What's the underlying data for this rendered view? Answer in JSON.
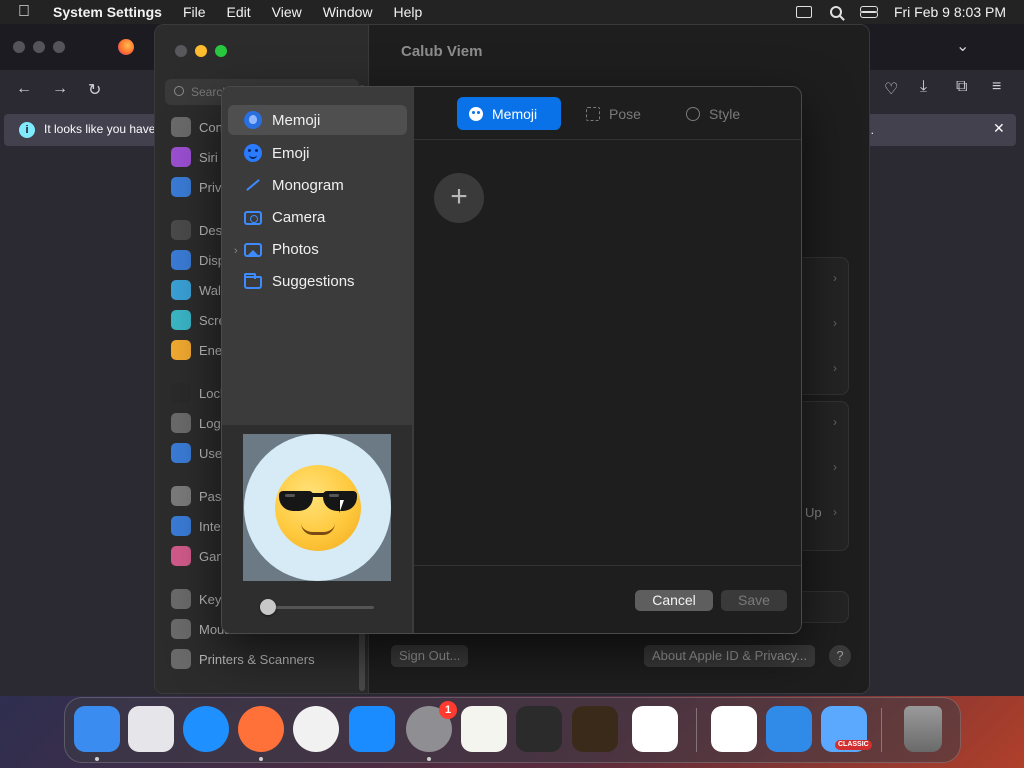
{
  "menubar": {
    "app_name": "System Settings",
    "menus": [
      "File",
      "Edit",
      "View",
      "Window",
      "Help"
    ],
    "clock": "Fri Feb 9  8:03 PM"
  },
  "browser": {
    "notice_text": "It looks like you haven't",
    "notice_suffix": "fox...",
    "close_glyph": "✕"
  },
  "settings": {
    "window_title": "Calub Viem",
    "search_placeholder": "Search",
    "sidebar_items": [
      {
        "label": "Con",
        "color": "#6a6a6a"
      },
      {
        "label": "Siri",
        "color": "#9b4fd1"
      },
      {
        "label": "Priv",
        "color": "#3a7bd5"
      },
      {
        "label": "Des",
        "color": "#4a4a4a"
      },
      {
        "label": "Disp",
        "color": "#3a7bd5"
      },
      {
        "label": "Wall",
        "color": "#3aa0d5"
      },
      {
        "label": "Scre",
        "color": "#3ab5c5"
      },
      {
        "label": "Ene",
        "color": "#f0a830"
      },
      {
        "label": "Lock",
        "color": "#2a2a2a"
      },
      {
        "label": "Logi",
        "color": "#6a6a6a"
      },
      {
        "label": "Use",
        "color": "#3a7bd5"
      },
      {
        "label": "Pass",
        "color": "#7a7a7a"
      },
      {
        "label": "Inter",
        "color": "#3a7bd5"
      },
      {
        "label": "Gam",
        "color": "#d05a8a"
      },
      {
        "label": "Keyb",
        "color": "#6a6a6a"
      },
      {
        "label": "Mouse",
        "color": "#6a6a6a"
      },
      {
        "label": "Printers & Scanners",
        "color": "#6a6a6a"
      }
    ],
    "up_text": "Up",
    "sign_out": "Sign Out...",
    "about": "About Apple ID & Privacy...",
    "help": "?"
  },
  "dialog": {
    "sources": [
      {
        "label": "Memoji",
        "icon": "memoji-icon"
      },
      {
        "label": "Emoji",
        "icon": "emoji-icon"
      },
      {
        "label": "Monogram",
        "icon": "monogram-icon"
      },
      {
        "label": "Camera",
        "icon": "camera-icon"
      },
      {
        "label": "Photos",
        "icon": "photos-icon"
      },
      {
        "label": "Suggestions",
        "icon": "folder-icon"
      }
    ],
    "selected_source": "Memoji",
    "tabs": [
      {
        "label": "Memoji",
        "active": true
      },
      {
        "label": "Pose",
        "active": false
      },
      {
        "label": "Style",
        "active": false
      }
    ],
    "add_glyph": "+",
    "zoom_level": 0.0,
    "cancel_label": "Cancel",
    "save_label": "Save"
  },
  "dock": {
    "apps": [
      {
        "name": "Finder",
        "color": "#3b8cf0",
        "running": true
      },
      {
        "name": "Launchpad",
        "color": "#e6e6ea",
        "running": false
      },
      {
        "name": "Safari",
        "color": "#1e90ff",
        "running": false
      },
      {
        "name": "Firefox",
        "color": "#ff7139",
        "running": true
      },
      {
        "name": "Chrome",
        "color": "#f1f1f1",
        "running": false
      },
      {
        "name": "App Store",
        "color": "#1a8cff",
        "running": false
      },
      {
        "name": "System Settings",
        "color": "#8e8e93",
        "running": true,
        "badge": "1"
      },
      {
        "name": "TextEdit",
        "color": "#f5f5f0",
        "running": false
      },
      {
        "name": "Terminal",
        "color": "#2b2b2b",
        "running": false
      },
      {
        "name": "GarageBand",
        "color": "#3a2a1a",
        "running": false
      },
      {
        "name": "VS Code",
        "color": "#ffffff",
        "running": false
      },
      {
        "name": "Visual Studio",
        "color": "#ffffff",
        "running": false
      },
      {
        "name": "Weather",
        "color": "#2f8ae8",
        "running": false
      },
      {
        "name": "Classic",
        "color": "#5aa9ff",
        "running": false,
        "tag": "CLASSIC"
      },
      {
        "name": "Trash",
        "color": "#7a7a7a",
        "running": false
      }
    ]
  }
}
